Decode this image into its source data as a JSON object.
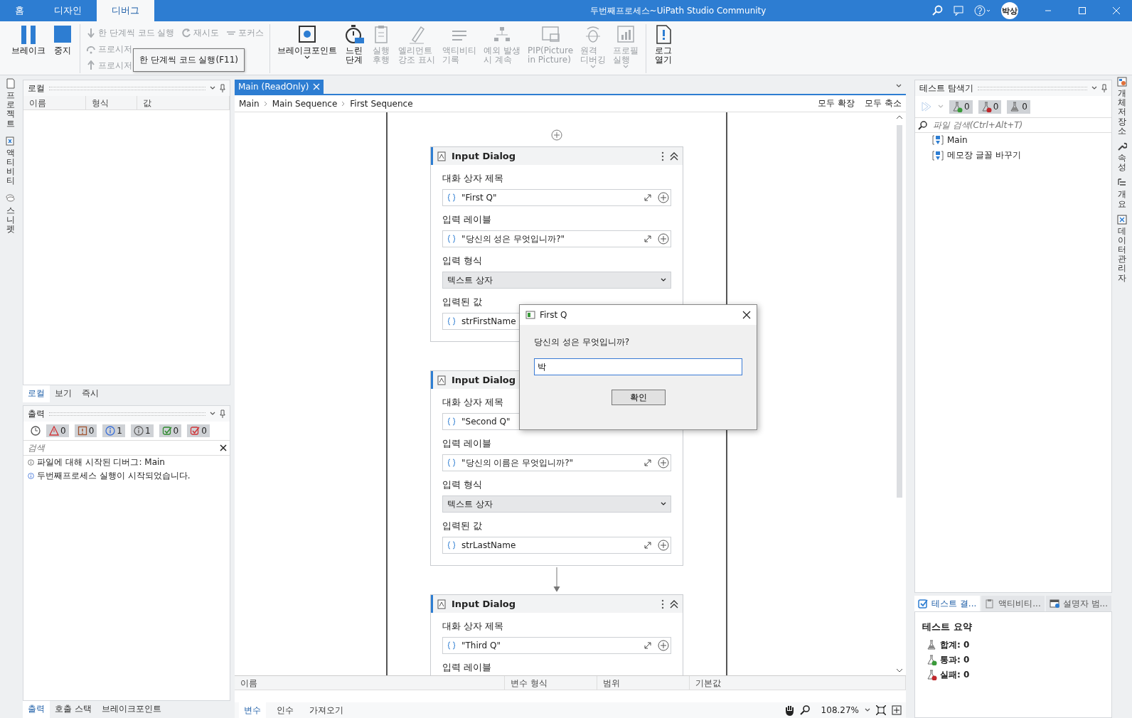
{
  "title_bar": {
    "tabs": [
      {
        "label": "홈",
        "selected": false
      },
      {
        "label": "디자인",
        "selected": false
      },
      {
        "label": "디버그",
        "selected": true
      }
    ],
    "title": "두번째프로세스~UiPath Studio Community",
    "avatar": "박상"
  },
  "ribbon": {
    "groups": [
      {
        "items": [
          {
            "lines": [
              "브레이크"
            ],
            "kind": "pause",
            "disabled": false
          },
          {
            "lines": [
              "중지"
            ],
            "kind": "stop",
            "disabled": false
          }
        ]
      },
      {
        "rows": [
          [
            {
              "label": "한 단계씩 코드 실행",
              "kind": "step-into",
              "disabled": true
            },
            {
              "label": "재시도",
              "kind": "retry",
              "disabled": true
            },
            {
              "label": "포커스",
              "kind": "focus",
              "disabled": true
            }
          ],
          [
            {
              "label": "프로시저",
              "kind": "step-over",
              "disabled": true
            }
          ],
          [
            {
              "label": "프로시저",
              "kind": "step-out",
              "disabled": true
            }
          ]
        ]
      },
      {
        "items": [
          {
            "lines": [
              "브레이크포인트"
            ],
            "kind": "breakpoint",
            "menu": true,
            "disabled": false
          },
          {
            "lines": [
              "느린",
              "단계"
            ],
            "kind": "slow-step",
            "disabled": false
          },
          {
            "lines": [
              "실행",
              "후행"
            ],
            "kind": "clipboard",
            "disabled": true
          },
          {
            "lines": [
              "엘리먼트",
              "강조 표시"
            ],
            "kind": "highlight",
            "disabled": true
          },
          {
            "lines": [
              "액티비티",
              "기록"
            ],
            "kind": "list",
            "disabled": true
          },
          {
            "lines": [
              "예외 발생",
              "시 계속"
            ],
            "kind": "tree",
            "disabled": true
          },
          {
            "lines": [
              "PIP(Picture",
              "in Picture)"
            ],
            "kind": "pip",
            "disabled": true
          },
          {
            "lines": [
              "원격",
              "디버깅"
            ],
            "kind": "remote",
            "menu": true,
            "disabled": true
          },
          {
            "lines": [
              "프로필",
              "실행"
            ],
            "kind": "chart",
            "menu": true,
            "disabled": true
          }
        ]
      },
      {
        "items": [
          {
            "lines": [
              "로그",
              "열기"
            ],
            "kind": "log",
            "disabled": false
          }
        ]
      }
    ],
    "tooltip": "한 단계씩 코드 실행(F11)"
  },
  "left_dock": [
    {
      "label": "프로젝트",
      "kind": "project"
    },
    {
      "label": "액티비티",
      "kind": "activities"
    },
    {
      "label": "스니펫",
      "kind": "snippets"
    }
  ],
  "locals": {
    "title": "로컬",
    "columns": [
      "이름",
      "형식",
      "값"
    ]
  },
  "locals_tabs": [
    {
      "label": "로컬",
      "selected": true
    },
    {
      "label": "보기",
      "selected": false
    },
    {
      "label": "즉시",
      "selected": false
    }
  ],
  "output": {
    "title": "출력",
    "filters": [
      {
        "kind": "error",
        "count": "0"
      },
      {
        "kind": "warning",
        "count": "0"
      },
      {
        "kind": "info",
        "count": "1"
      },
      {
        "kind": "trace",
        "count": "1"
      },
      {
        "kind": "success",
        "count": "0"
      },
      {
        "kind": "failure",
        "count": "0"
      }
    ],
    "search": {
      "placeholder": "검색"
    },
    "lines": [
      {
        "kind": "trace",
        "text": "파일에 대해 시작된 디버그: Main"
      },
      {
        "kind": "info",
        "text": "두번째프로세스 실행이 시작되었습니다."
      }
    ]
  },
  "output_tabs": [
    {
      "label": "출력",
      "selected": true
    },
    {
      "label": "호출 스택",
      "selected": false
    },
    {
      "label": "브레이크포인트",
      "selected": false
    }
  ],
  "document": {
    "tab": "Main (ReadOnly)",
    "breadcrumb": [
      "Main",
      "Main Sequence",
      "First Sequence"
    ],
    "actions": [
      "모두 확장",
      "모두 축소"
    ],
    "cards": [
      {
        "title": "Input Dialog",
        "fields": [
          {
            "label": "대화 상자 제목",
            "kind": "expression",
            "value": "\"First Q\""
          },
          {
            "label": "입력 레이블",
            "kind": "expression",
            "value": "\"당신의 성은 무엇입니까?\""
          },
          {
            "label": "입력 형식",
            "kind": "dropdown",
            "value": "텍스트 상자"
          },
          {
            "label": "입력된 값",
            "kind": "expression",
            "value": "strFirstName"
          }
        ]
      },
      {
        "title": "Input Dialog",
        "fields": [
          {
            "label": "대화 상자 제목",
            "kind": "expression",
            "value": "\"Second Q\""
          },
          {
            "label": "입력 레이블",
            "kind": "expression",
            "value": "\"당신의 이름은 무엇입니까?\""
          },
          {
            "label": "입력 형식",
            "kind": "dropdown",
            "value": "텍스트 상자"
          },
          {
            "label": "입력된 값",
            "kind": "expression",
            "value": "strLastName"
          }
        ]
      },
      {
        "title": "Input Dialog",
        "fields": [
          {
            "label": "대화 상자 제목",
            "kind": "expression",
            "value": "\"Third Q\""
          },
          {
            "label": "입력 레이블"
          }
        ]
      }
    ]
  },
  "variables": {
    "columns": [
      "이름",
      "변수 형식",
      "범위",
      "기본값"
    ]
  },
  "variable_tabs": [
    {
      "label": "변수",
      "selected": true
    },
    {
      "label": "인수",
      "selected": false
    },
    {
      "label": "가져오기",
      "selected": false
    }
  ],
  "zoom": "108.27%",
  "dialog": {
    "title": "First Q",
    "prompt": "당신의 성은 무엇입니까?",
    "value": "박",
    "button": "확인"
  },
  "test_explorer": {
    "title": "테스트 탐색기",
    "counters": [
      {
        "kind": "passed",
        "count": "0"
      },
      {
        "kind": "failed",
        "count": "0"
      },
      {
        "kind": "total",
        "count": "0"
      }
    ],
    "search": {
      "placeholder": "파일 검색(Ctrl+Alt+T)"
    },
    "files": [
      "Main",
      "메모장 글꼴 바꾸기"
    ]
  },
  "results_tabs": [
    {
      "label": "테스트 결...",
      "kind": "check",
      "selected": true
    },
    {
      "label": "액티비티...",
      "kind": "clipboard",
      "selected": false
    },
    {
      "label": "설명자 범...",
      "kind": "descriptor",
      "selected": false
    }
  ],
  "summary": {
    "title": "테스트 요약",
    "lines": [
      {
        "kind": "total",
        "text": "합계: 0"
      },
      {
        "kind": "passed",
        "text": "통과: 0"
      },
      {
        "kind": "failed",
        "text": "실패: 0"
      }
    ]
  },
  "right_dock": [
    {
      "label": "개체 저장소",
      "kind": "repository"
    },
    {
      "label": "속성",
      "kind": "wrench"
    },
    {
      "label": "개요",
      "kind": "outline"
    },
    {
      "label": "데이터 관리자",
      "kind": "data"
    }
  ]
}
